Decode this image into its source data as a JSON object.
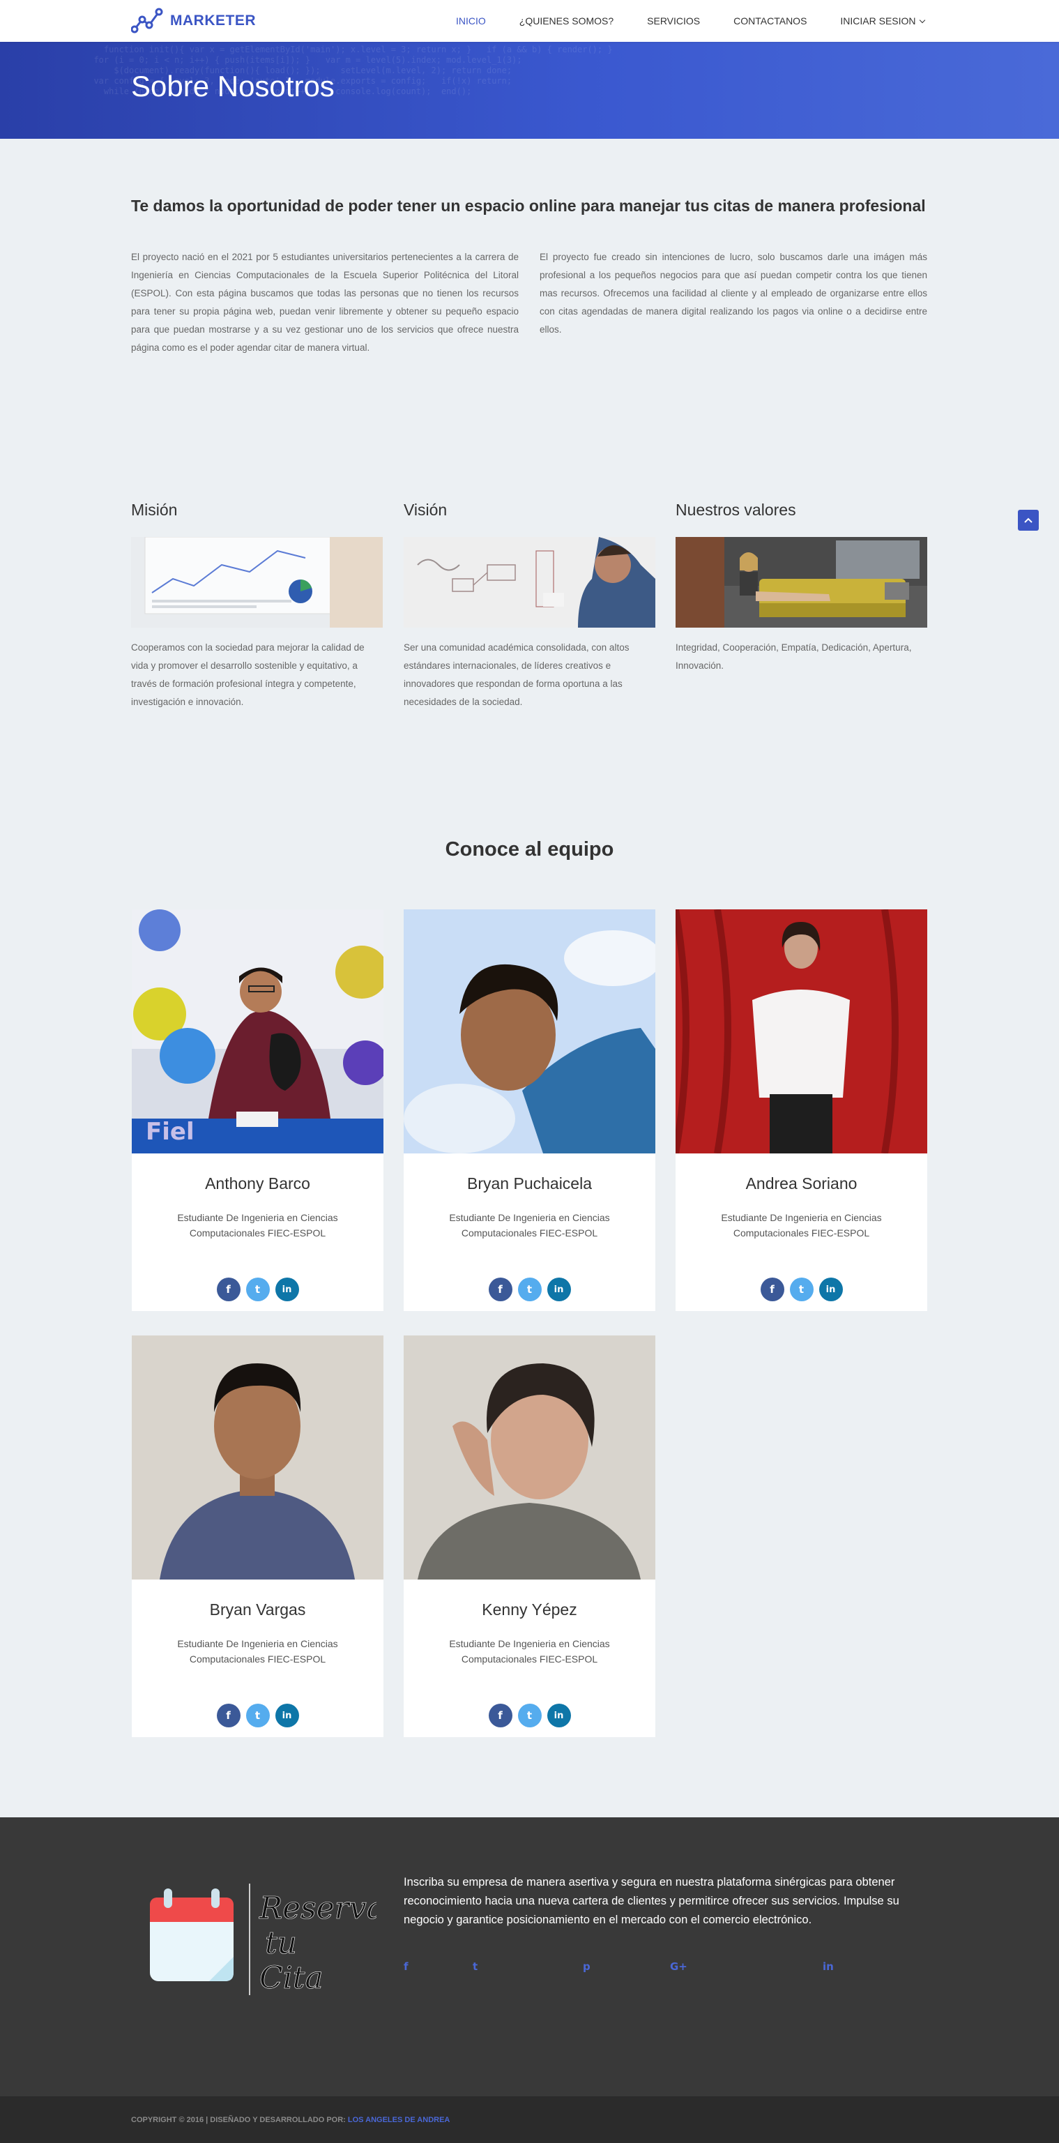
{
  "header": {
    "brand": "MARKETER",
    "nav": [
      {
        "label": "INICIO",
        "active": true
      },
      {
        "label": "¿QUIENES SOMOS?",
        "active": false
      },
      {
        "label": "SERVICIOS",
        "active": false
      },
      {
        "label": "CONTACTANOS",
        "active": false
      },
      {
        "label": "INICIAR SESION",
        "active": false,
        "dropdown": true
      }
    ]
  },
  "hero": {
    "title": "Sobre Nosotros"
  },
  "intro": {
    "heading": "Te damos la oportunidad de poder tener un espacio online para manejar tus citas de manera profesional",
    "left": "El proyecto nació en el 2021 por 5 estudiantes universitarios pertenecientes a la carrera de Ingeniería en Ciencias Computacionales de la Escuela Superior Politécnica del Litoral (ESPOL). Con esta página buscamos que todas las personas que no tienen los recursos para tener su propia página web, puedan venir libremente y obtener su pequeño espacio para que puedan mostrarse y a su vez gestionar uno de los servicios que ofrece nuestra página como es el poder agendar citar de manera virtual.",
    "right": "El proyecto fue creado sin intenciones de lucro, solo buscamos darle una imágen más profesional a los pequeños negocios para que así puedan competir contra los que tienen mas recursos. Ofrecemos una facilidad al cliente y al empleado de organizarse entre ellos con citas agendadas de manera digital realizando los pagos via online o a decidirse entre ellos."
  },
  "mvv": [
    {
      "title": "Misión",
      "text": "Cooperamos con la sociedad para mejorar la calidad de vida y promover el desarrollo sostenible y equitativo, a través de formación profesional íntegra y competente, investigación e innovación."
    },
    {
      "title": "Visión",
      "text": "Ser una comunidad académica consolidada, con altos estándares internacionales, de líderes creativos e innovadores que respondan de forma oportuna a las necesidades de la sociedad."
    },
    {
      "title": "Nuestros valores",
      "text": "Integridad, Cooperación, Empatía, Dedicación, Apertura, Innovación."
    }
  ],
  "team": {
    "title": "Conoce al equipo",
    "members": [
      {
        "name": "Anthony Barco",
        "role": "Estudiante De Ingenieria en Ciencias Computacionales FIEC-ESPOL"
      },
      {
        "name": "Bryan Puchaicela",
        "role": "Estudiante De Ingenieria en Ciencias Computacionales FIEC-ESPOL"
      },
      {
        "name": "Andrea Soriano",
        "role": "Estudiante De Ingenieria en Ciencias Computacionales FIEC-ESPOL"
      },
      {
        "name": "Bryan Vargas",
        "role": "Estudiante De Ingenieria en Ciencias Computacionales FIEC-ESPOL"
      },
      {
        "name": "Kenny Yépez",
        "role": "Estudiante De Ingenieria en Ciencias Computacionales FIEC-ESPOL"
      }
    ],
    "social_icons": {
      "facebook": "f",
      "twitter": "t",
      "linkedin": "in"
    }
  },
  "footer": {
    "logo_text": [
      "Reserva",
      "tu",
      "Cita"
    ],
    "text": "Inscriba su empresa de manera asertiva y segura en nuestra plataforma sinérgicas para obtener reconocimiento hacia una nueva cartera de clientes y permitirce ofrecer sus servicios. Impulse su negocio y garantice posicionamiento en el mercado con el comercio electrónico.",
    "social": {
      "facebook": "f",
      "twitter": "t",
      "pinterest": "p",
      "googleplus": "G+",
      "linkedin": "in"
    },
    "copyright_prefix": "COPYRIGHT © 2016 | DISEÑADO Y DESARROLLADO POR:",
    "copyright_link": "LOS ANGELES DE ANDREA"
  },
  "colors": {
    "accent": "#3b55c4",
    "footer": "#393939",
    "facebook": "#3b5998",
    "twitter": "#55acee",
    "linkedin": "#0e76a8"
  }
}
